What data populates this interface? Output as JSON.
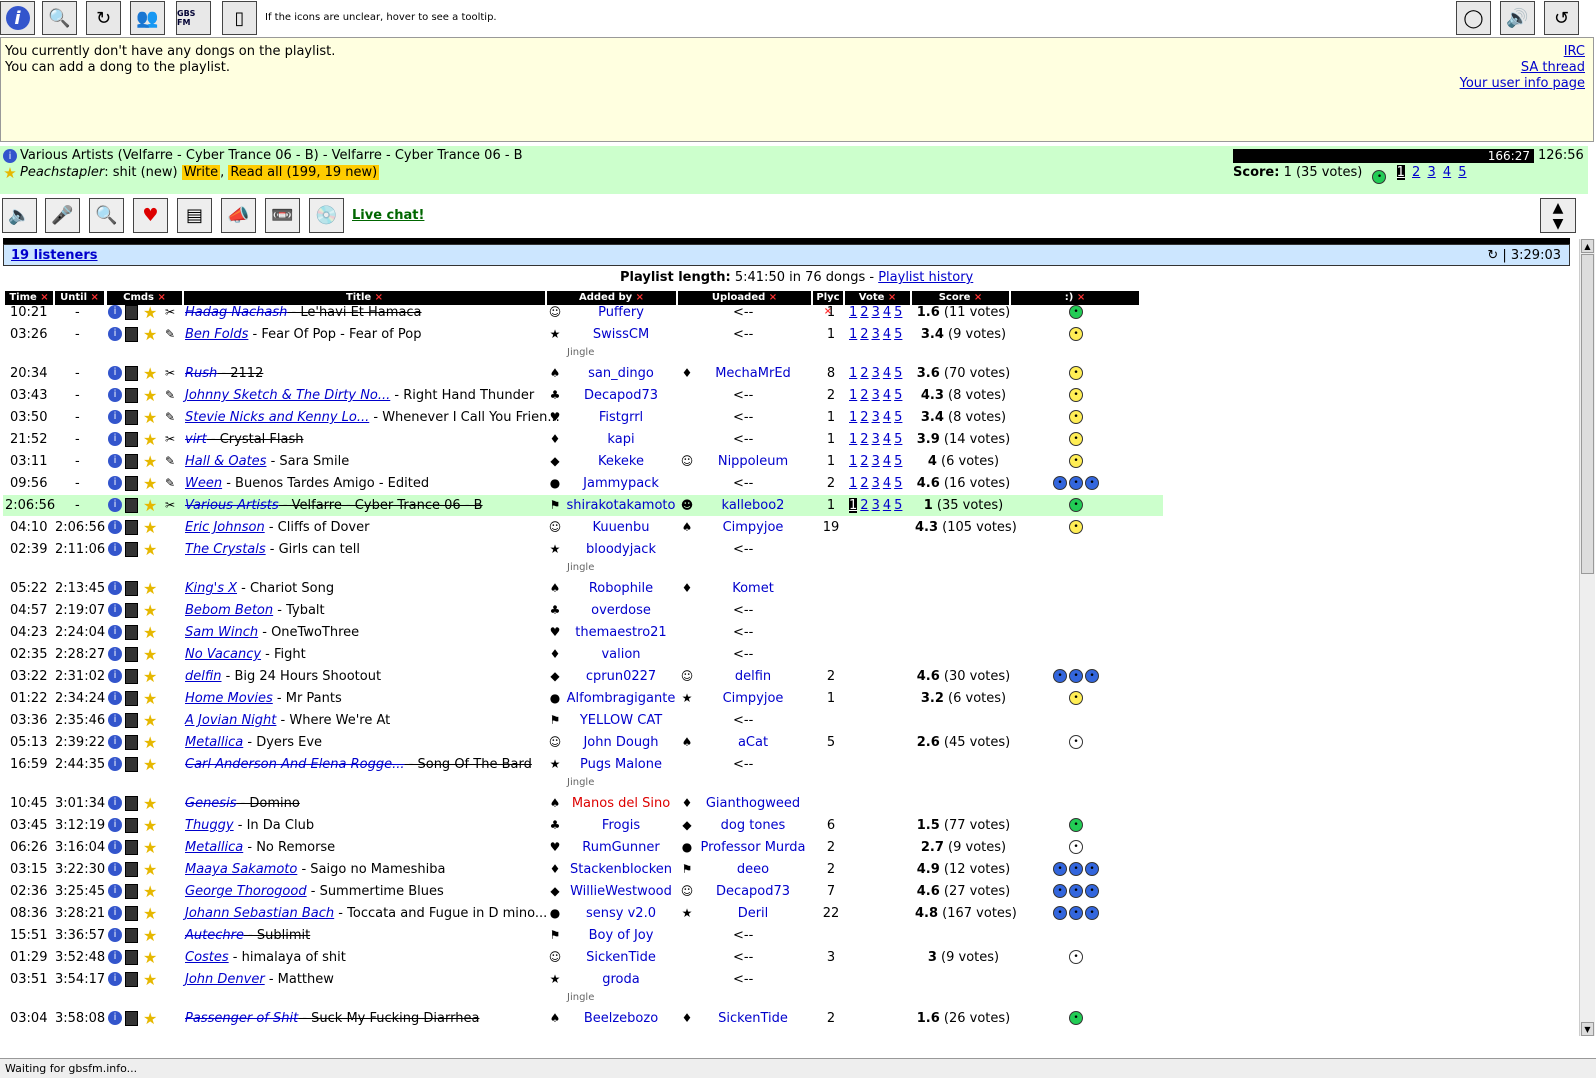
{
  "toolbar": {
    "hint": "If the icons are unclear, hover to see a tooltip.",
    "gbs_label": "GBS FM"
  },
  "message": {
    "line1": "You currently don't have any dongs on the playlist.",
    "line2": "You can add a dong to the playlist.",
    "links": [
      "IRC",
      "SA thread",
      "Your user info page"
    ]
  },
  "now_playing": {
    "title": "Various Artists (Velfarre - Cyber Trance 06 - B) - Velfarre - Cyber Trance 06 - B",
    "comment_user": "Peachstapler",
    "comment_text": ": shit (new) ",
    "write_label": "Write",
    "readall_label": "Read all (199, 19 new)",
    "elapsed": "166:27",
    "total": "126:56",
    "score_label": "Score:",
    "score_value": "1 (35 votes)",
    "vote_options": [
      "1",
      "2",
      "3",
      "4",
      "5"
    ]
  },
  "live_chat": "Live chat!",
  "listeners": {
    "link": "19 listeners",
    "time": "| 3:29:03"
  },
  "playlist_length": {
    "label": "Playlist length:",
    "value": " 5:41:50 in 76 dongs - ",
    "history": "Playlist history"
  },
  "headers": [
    "Time",
    "Until",
    "Cmds",
    "Title",
    "Added by",
    "Uploaded",
    "Plyc",
    "Vote",
    "Score",
    ":)"
  ],
  "jingle_label": "Jingle",
  "rows": [
    {
      "time": "10:21",
      "until": "-",
      "artist": "Hadag Nachash",
      "title": "Le'havi Et Hamaca",
      "strike": true,
      "adder": "Puffery",
      "uploader": "<--",
      "plays": "1",
      "vote": true,
      "score": "1.6",
      "votes": "(11 votes)",
      "smile": "green"
    },
    {
      "time": "03:26",
      "until": "-",
      "artist": "Ben Folds",
      "title": "Fear Of Pop - Fear of Pop",
      "strike": false,
      "adder": "SwissCM",
      "uploader": "<--",
      "plays": "1",
      "vote": true,
      "score": "3.4",
      "votes": "(9 votes)",
      "smile": "yellow"
    },
    {
      "jingle": true
    },
    {
      "time": "20:34",
      "until": "-",
      "artist": "Rush",
      "title": "2112",
      "strike": true,
      "adder": "san_dingo",
      "uploader": "MechaMrEd",
      "plays": "8",
      "vote": true,
      "score": "3.6",
      "votes": "(70 votes)",
      "smile": "yellow"
    },
    {
      "time": "03:43",
      "until": "-",
      "artist": "Johnny Sketch & The Dirty No...",
      "title": "Right Hand Thunder",
      "strike": false,
      "adder": "Decapod73",
      "uploader": "<--",
      "plays": "2",
      "vote": true,
      "score": "4.3",
      "votes": "(8 votes)",
      "smile": "yellow"
    },
    {
      "time": "03:50",
      "until": "-",
      "artist": "Stevie Nicks and Kenny Lo...",
      "title": "Whenever I Call You Frien...",
      "strike": false,
      "adder": "Fistgrrl",
      "uploader": "<--",
      "plays": "1",
      "vote": true,
      "score": "3.4",
      "votes": "(8 votes)",
      "smile": "yellow"
    },
    {
      "time": "21:52",
      "until": "-",
      "artist": "virt",
      "title": "Crystal Flash",
      "strike": true,
      "adder": "kapi",
      "uploader": "<--",
      "plays": "1",
      "vote": true,
      "score": "3.9",
      "votes": "(14 votes)",
      "smile": "yellow"
    },
    {
      "time": "03:11",
      "until": "-",
      "artist": "Hall & Oates",
      "title": "Sara Smile",
      "strike": false,
      "adder": "Kekeke",
      "uploader": "Nippoleum",
      "plays": "1",
      "vote": true,
      "score": "4",
      "votes": "(6 votes)",
      "smile": "yellow"
    },
    {
      "time": "09:56",
      "until": "-",
      "artist": "Ween",
      "title": "Buenos Tardes Amigo - Edited",
      "strike": false,
      "adder": "Jammypack",
      "uploader": "<--",
      "plays": "2",
      "vote": true,
      "score": "4.6",
      "votes": "(16 votes)",
      "smile": "blue"
    },
    {
      "time": "2:06:56",
      "until": "-",
      "artist": "Various Artists",
      "title": "Velfarre - Cyber Trance 06 - B",
      "strike": true,
      "adder": "shirakotakamoto",
      "uploader": "kalleboo2",
      "plays": "1",
      "vote": true,
      "score": "1",
      "votes": "(35 votes)",
      "smile": "green",
      "current": true
    },
    {
      "time": "04:10",
      "until": "2:06:56",
      "artist": "Eric Johnson",
      "title": "Cliffs of Dover",
      "strike": false,
      "adder": "Kuuenbu",
      "uploader": "Cimpyjoe",
      "plays": "19",
      "vote": false,
      "score": "4.3",
      "votes": "(105 votes)",
      "smile": "yellow"
    },
    {
      "time": "02:39",
      "until": "2:11:06",
      "artist": "The Crystals",
      "title": "Girls can tell",
      "strike": false,
      "adder": "bloodyjack",
      "uploader": "<--",
      "plays": "",
      "vote": false,
      "score": "",
      "votes": "",
      "smile": ""
    },
    {
      "jingle": true
    },
    {
      "time": "05:22",
      "until": "2:13:45",
      "artist": "King's X",
      "title": "Chariot Song",
      "strike": false,
      "adder": "Robophile",
      "uploader": "Komet",
      "plays": "",
      "vote": false,
      "score": "",
      "votes": "",
      "smile": ""
    },
    {
      "time": "04:57",
      "until": "2:19:07",
      "artist": "Bebom Beton",
      "title": "Tybalt",
      "strike": false,
      "adder": "overdose",
      "uploader": "<--",
      "plays": "",
      "vote": false,
      "score": "",
      "votes": "",
      "smile": ""
    },
    {
      "time": "04:23",
      "until": "2:24:04",
      "artist": "Sam Winch",
      "title": "OneTwoThree",
      "strike": false,
      "adder": "themaestro21",
      "uploader": "<--",
      "plays": "",
      "vote": false,
      "score": "",
      "votes": "",
      "smile": ""
    },
    {
      "time": "02:35",
      "until": "2:28:27",
      "artist": "No Vacancy",
      "title": "Fight",
      "strike": false,
      "adder": "valion",
      "uploader": "<--",
      "plays": "",
      "vote": false,
      "score": "",
      "votes": "",
      "smile": ""
    },
    {
      "time": "03:22",
      "until": "2:31:02",
      "artist": "delfin",
      "title": "Big 24 Hours Shootout",
      "strike": false,
      "adder": "cprun0227",
      "uploader": "delfin",
      "plays": "2",
      "vote": false,
      "score": "4.6",
      "votes": "(30 votes)",
      "smile": "blue"
    },
    {
      "time": "01:22",
      "until": "2:34:24",
      "artist": "Home Movies",
      "title": "Mr Pants",
      "strike": false,
      "adder": "Alfombragigante",
      "uploader": "Cimpyjoe",
      "plays": "1",
      "vote": false,
      "score": "3.2",
      "votes": "(6 votes)",
      "smile": "yellow"
    },
    {
      "time": "03:36",
      "until": "2:35:46",
      "artist": "A Jovian Night",
      "title": "Where We're At",
      "strike": false,
      "adder": "YELLOW CAT",
      "uploader": "<--",
      "plays": "",
      "vote": false,
      "score": "",
      "votes": "",
      "smile": ""
    },
    {
      "time": "05:13",
      "until": "2:39:22",
      "artist": "Metallica",
      "title": "Dyers Eve",
      "strike": false,
      "adder": "John Dough",
      "uploader": "aCat",
      "plays": "5",
      "vote": false,
      "score": "2.6",
      "votes": "(45 votes)",
      "smile": "white"
    },
    {
      "time": "16:59",
      "until": "2:44:35",
      "artist": "Carl Anderson And Elena Rogge...",
      "title": "Song Of The Bard",
      "strike": true,
      "adder": "Pugs Malone",
      "uploader": "<--",
      "plays": "",
      "vote": false,
      "score": "",
      "votes": "",
      "smile": ""
    },
    {
      "jingle": true
    },
    {
      "time": "10:45",
      "until": "3:01:34",
      "artist": "Genesis",
      "title": "Domino",
      "strike": true,
      "adder": "Manos del Sino",
      "adder_red": true,
      "uploader": "Gianthogweed",
      "plays": "",
      "vote": false,
      "score": "",
      "votes": "",
      "smile": ""
    },
    {
      "time": "03:45",
      "until": "3:12:19",
      "artist": "Thuggy",
      "title": "In Da Club",
      "strike": false,
      "adder": "Frogis",
      "uploader": "dog tones",
      "plays": "6",
      "vote": false,
      "score": "1.5",
      "votes": "(77 votes)",
      "smile": "green"
    },
    {
      "time": "06:26",
      "until": "3:16:04",
      "artist": "Metallica",
      "title": "No Remorse",
      "strike": false,
      "adder": "RumGunner",
      "uploader": "Professor Murda",
      "plays": "2",
      "vote": false,
      "score": "2.7",
      "votes": "(9 votes)",
      "smile": "white"
    },
    {
      "time": "03:15",
      "until": "3:22:30",
      "artist": "Maaya Sakamoto",
      "title": "Saigo no Mameshiba",
      "strike": false,
      "adder": "Stackenblocken",
      "uploader": "deeo",
      "plays": "2",
      "vote": false,
      "score": "4.9",
      "votes": "(12 votes)",
      "smile": "blue"
    },
    {
      "time": "02:36",
      "until": "3:25:45",
      "artist": "George Thorogood",
      "title": "Summertime Blues",
      "strike": false,
      "adder": "WillieWestwood",
      "uploader": "Decapod73",
      "plays": "7",
      "vote": false,
      "score": "4.6",
      "votes": "(27 votes)",
      "smile": "blue"
    },
    {
      "time": "08:36",
      "until": "3:28:21",
      "artist": "Johann Sebastian Bach",
      "title": "Toccata and Fugue in D mino...",
      "strike": false,
      "adder": "sensy v2.0",
      "uploader": "Deril",
      "plays": "22",
      "vote": false,
      "score": "4.8",
      "votes": "(167 votes)",
      "smile": "blue"
    },
    {
      "time": "15:51",
      "until": "3:36:57",
      "artist": "Autechre",
      "title": "Sublimit",
      "strike": true,
      "adder": "Boy of Joy",
      "uploader": "<--",
      "plays": "",
      "vote": false,
      "score": "",
      "votes": "",
      "smile": ""
    },
    {
      "time": "01:29",
      "until": "3:52:48",
      "artist": "Costes",
      "title": "himalaya of shit",
      "strike": false,
      "adder": "SickenTide",
      "uploader": "<--",
      "plays": "3",
      "vote": false,
      "score": "3",
      "votes": "(9 votes)",
      "smile": "white"
    },
    {
      "time": "03:51",
      "until": "3:54:17",
      "artist": "John Denver",
      "title": "Matthew",
      "strike": false,
      "adder": "groda",
      "uploader": "<--",
      "plays": "",
      "vote": false,
      "score": "",
      "votes": "",
      "smile": ""
    },
    {
      "jingle": true
    },
    {
      "time": "03:04",
      "until": "3:58:08",
      "artist": "Passenger of Shit",
      "title": "Suck My Fucking Diarrhea",
      "strike": true,
      "adder": "Beelzebozo",
      "uploader": "SickenTide",
      "plays": "2",
      "vote": false,
      "score": "1.6",
      "votes": "(26 votes)",
      "smile": "green"
    }
  ],
  "status": "Waiting for gbsfm.info...",
  "colors": {
    "accent": "#0000cc",
    "now_bg": "#ccffcc",
    "message_bg": "#ffffe0",
    "listeners_bg": "#cce6ff"
  }
}
